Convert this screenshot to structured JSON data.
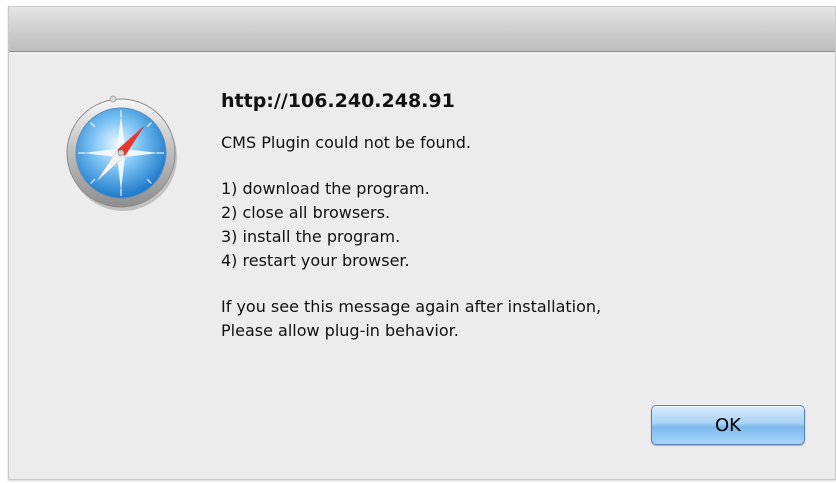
{
  "dialog": {
    "title": "http://106.240.248.91",
    "lead": "CMS Plugin could not be found.",
    "steps": [
      "1) download the program.",
      "2) close all browsers.",
      "3) install the program.",
      "4) restart your browser."
    ],
    "note_line1": "If you see this message again after installation,",
    "note_line2": "Please allow plug-in behavior.",
    "ok_label": "OK",
    "icon": "safari-compass-icon"
  },
  "colors": {
    "window_bg": "#ececec",
    "button_accent": "#7db8ec"
  }
}
